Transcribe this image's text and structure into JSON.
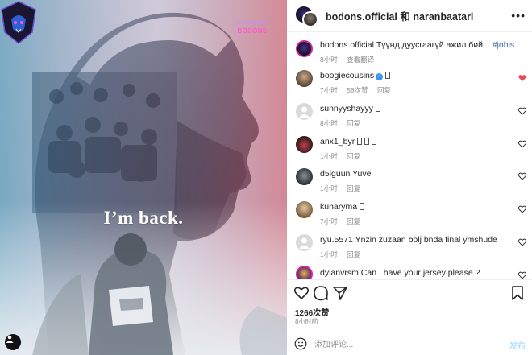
{
  "poster": {
    "headline": "I’m back.",
    "team_logo_text": "BODONS",
    "team_logo_top": "ULAANBAATAR"
  },
  "header": {
    "account1": "bodons.official",
    "conjunction": "和",
    "account2": "naranbaatarl"
  },
  "caption": {
    "user": "bodons.official",
    "text": "Түүнд дуусгаагүй ажил бий...",
    "hashtag": "#jobisnotfinished",
    "time": "8小时",
    "translate": "查看翻译"
  },
  "comments": [
    {
      "user": "boogiecousins",
      "verified": true,
      "text": "",
      "time": "7小时",
      "likes": "58次赞",
      "reply": "回复",
      "liked": true,
      "has_emoji": true
    },
    {
      "user": "sunnyyshayyy",
      "verified": false,
      "text": "",
      "time": "8小时",
      "likes": "",
      "reply": "回复",
      "liked": false,
      "has_emoji": true
    },
    {
      "user": "anx1_byr",
      "verified": false,
      "text": "",
      "time": "1小时",
      "likes": "",
      "reply": "回复",
      "liked": false,
      "has_emoji": true
    },
    {
      "user": "d5lguun",
      "verified": false,
      "text": "Yuve",
      "time": "1小时",
      "likes": "",
      "reply": "回复",
      "liked": false,
      "has_emoji": false
    },
    {
      "user": "kunaryma",
      "verified": false,
      "text": "",
      "time": "7小时",
      "likes": "",
      "reply": "回复",
      "liked": false,
      "has_emoji": true
    },
    {
      "user": "ryu.5571",
      "verified": false,
      "text": "Ynzin zuzaan bolj bnda final ymshude",
      "time": "1小时",
      "likes": "",
      "reply": "回复",
      "liked": false,
      "has_emoji": false
    },
    {
      "user": "dylanvrsm",
      "verified": false,
      "text": "Can I have your jersey please ?",
      "time": "",
      "likes": "",
      "reply": "",
      "liked": false,
      "has_emoji": false
    }
  ],
  "post": {
    "likes": "1266次赞",
    "time": "8小时前"
  },
  "composer": {
    "placeholder": "添加评论...",
    "post_label": "发布"
  },
  "icons": {
    "more": "more-options-icon",
    "like": "heart-icon",
    "comment": "comment-icon",
    "share": "share-icon",
    "save": "bookmark-icon",
    "emoji": "emoji-icon",
    "tag": "user-tag-icon"
  },
  "colors": {
    "liked": "#ed4956",
    "link": "#3c6ea8",
    "post_button": "#b2dffc",
    "logo_accent": "#ff5bd0"
  }
}
